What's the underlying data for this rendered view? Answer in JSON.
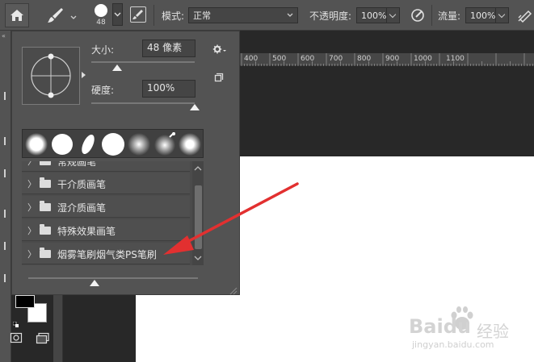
{
  "options_bar": {
    "brush_size_value": "48",
    "mode_label": "模式:",
    "mode_value": "正常",
    "opacity_label": "不透明度:",
    "opacity_value": "100%",
    "flow_label": "流量:",
    "flow_value": "100%"
  },
  "ruler": {
    "ticks": [
      "400",
      "500",
      "600",
      "700",
      "800",
      "900",
      "1000",
      "1100"
    ]
  },
  "brush_panel": {
    "size_label": "大小:",
    "size_value": "48 像素",
    "hardness_label": "硬度:",
    "hardness_value": "100%",
    "size_level": 0.25,
    "hardness_level": 1.0,
    "bottom_slider_level": 0.39,
    "partial_row": "常规画笔",
    "folders": [
      "干介质画笔",
      "湿介质画笔",
      "特殊效果画笔",
      "烟雾笔刷烟气类PS笔刷"
    ]
  },
  "watermark": {
    "brand": "Baidu",
    "brand_cn": "经验",
    "url": "jingyan.baidu.com"
  },
  "colors": {
    "panel": "#535353",
    "arrow": "#e23030",
    "canvas": "#ffffff"
  }
}
